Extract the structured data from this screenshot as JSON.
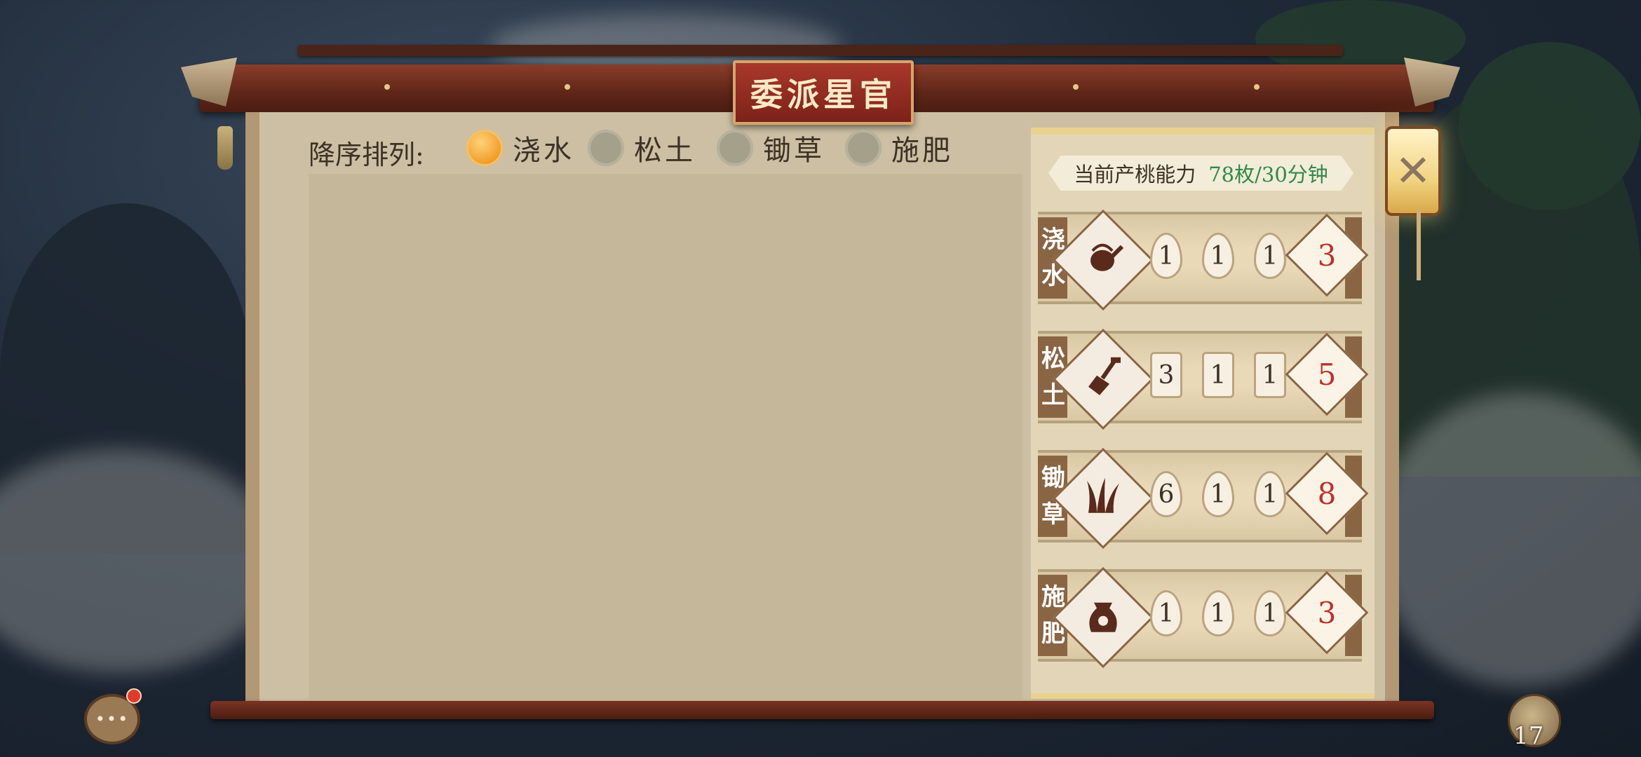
{
  "title": "委派星官",
  "sort": {
    "label": "降序排列:",
    "options": [
      {
        "label": "浇水",
        "selected": true
      },
      {
        "label": "松土",
        "selected": false
      },
      {
        "label": "锄草",
        "selected": false
      },
      {
        "label": "施肥",
        "selected": false
      }
    ]
  },
  "capacity": {
    "label": "当前产桃能力",
    "value": "78枚/30分钟"
  },
  "tasks": [
    {
      "name_top": "浇",
      "name_bottom": "水",
      "icon": "watering-can-icon",
      "values": [
        "1",
        "1",
        "1"
      ],
      "total": "3"
    },
    {
      "name_top": "松",
      "name_bottom": "土",
      "icon": "shovel-icon",
      "values": [
        "3",
        "1",
        "1"
      ],
      "total": "5"
    },
    {
      "name_top": "锄",
      "name_bottom": "草",
      "icon": "grass-icon",
      "values": [
        "6",
        "1",
        "1"
      ],
      "total": "8"
    },
    {
      "name_top": "施",
      "name_bottom": "肥",
      "icon": "fertilizer-bag-icon",
      "values": [
        "1",
        "1",
        "1"
      ],
      "total": "3"
    }
  ],
  "close_icon": "close-icon",
  "bottom": {
    "chat_icon": "chat-icon",
    "chat_glyph": "•••",
    "peach_icon": "peach-icon",
    "peach_count": "17"
  },
  "colors": {
    "accent_radio": "#f09a22",
    "capacity_value": "#2f8a4a",
    "total_red": "#c0302a",
    "title_bg": "#a8382a"
  }
}
